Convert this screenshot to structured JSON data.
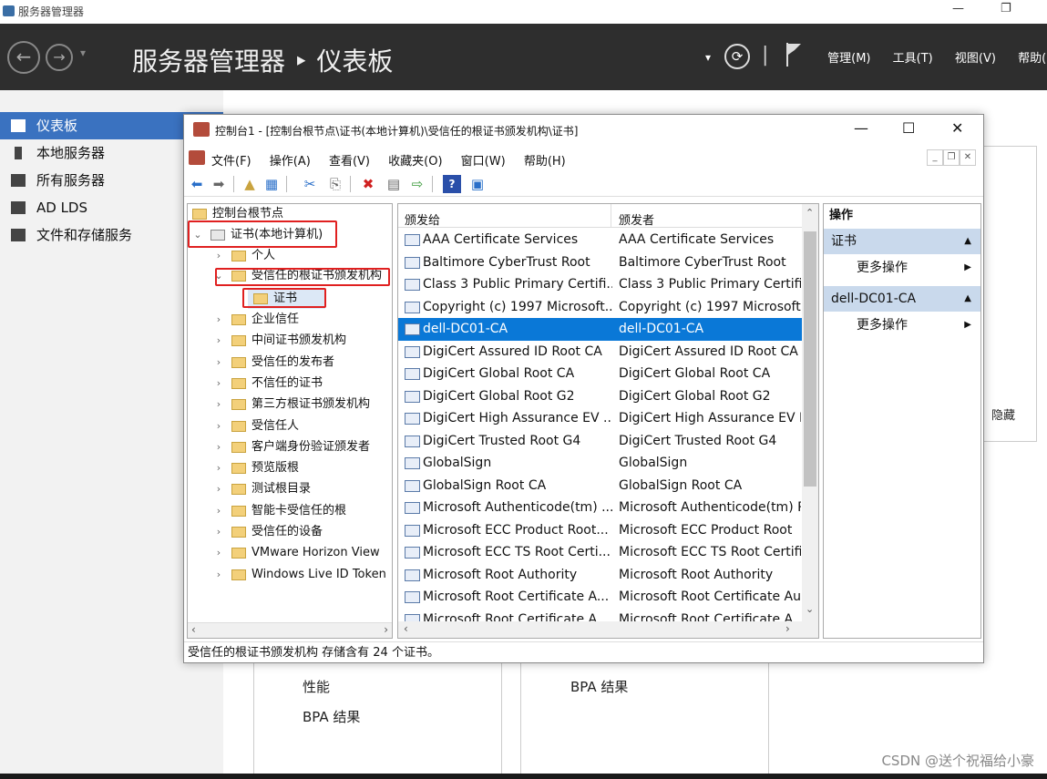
{
  "server_manager": {
    "window_title": "服务器管理器",
    "header_title": "服务器管理器 ‣ 仪表板",
    "menus": [
      "管理(M)",
      "工具(T)",
      "视图(V)",
      "帮助(H)"
    ],
    "sidebar": [
      {
        "label": "仪表板",
        "icon": "dashboard-icon",
        "active": true
      },
      {
        "label": "本地服务器",
        "icon": "server-icon"
      },
      {
        "label": "所有服务器",
        "icon": "servers-icon"
      },
      {
        "label": "AD LDS",
        "icon": "ad-lds-icon"
      },
      {
        "label": "文件和存储服务",
        "icon": "storage-icon"
      }
    ],
    "hide_label": "隐藏",
    "tiles_text": {
      "perf": "性能",
      "bpa1": "BPA 结果",
      "bpa2": "BPA 结果"
    },
    "watermark": "CSDN @送个祝福给小豪"
  },
  "mmc": {
    "title": "控制台1 - [控制台根节点\\证书(本地计算机)\\受信任的根证书颁发机构\\证书]",
    "menus": [
      "文件(F)",
      "操作(A)",
      "查看(V)",
      "收藏夹(O)",
      "窗口(W)",
      "帮助(H)"
    ],
    "tree": {
      "root": "控制台根节点",
      "computer": "证书(本地计算机)",
      "personal": "个人",
      "trusted_root": "受信任的根证书颁发机构",
      "certs": "证书",
      "others": [
        "企业信任",
        "中间证书颁发机构",
        "受信任的发布者",
        "不信任的证书",
        "第三方根证书颁发机构",
        "受信任人",
        "客户端身份验证颁发者",
        "预览版根",
        "测试根目录",
        "智能卡受信任的根",
        "受信任的设备",
        "VMware Horizon View",
        "Windows Live ID Token"
      ]
    },
    "list": {
      "col_issued_to": "颁发给",
      "col_issued_by": "颁发者",
      "selected_index": 4,
      "rows": [
        [
          "AAA Certificate Services",
          "AAA Certificate Services"
        ],
        [
          "Baltimore CyberTrust Root",
          "Baltimore CyberTrust Root"
        ],
        [
          "Class 3 Public Primary Certifi...",
          "Class 3 Public Primary Certific"
        ],
        [
          "Copyright (c) 1997 Microsoft...",
          "Copyright (c) 1997 Microsoft"
        ],
        [
          "dell-DC01-CA",
          "dell-DC01-CA"
        ],
        [
          "DigiCert Assured ID Root CA",
          "DigiCert Assured ID Root CA"
        ],
        [
          "DigiCert Global Root CA",
          "DigiCert Global Root CA"
        ],
        [
          "DigiCert Global Root G2",
          "DigiCert Global Root G2"
        ],
        [
          "DigiCert High Assurance EV ...",
          "DigiCert High Assurance EV R"
        ],
        [
          "DigiCert Trusted Root G4",
          "DigiCert Trusted Root G4"
        ],
        [
          "GlobalSign",
          "GlobalSign"
        ],
        [
          "GlobalSign Root CA",
          "GlobalSign Root CA"
        ],
        [
          "Microsoft Authenticode(tm) ...",
          "Microsoft Authenticode(tm) R"
        ],
        [
          "Microsoft ECC Product Root...",
          "Microsoft ECC Product Root"
        ],
        [
          "Microsoft ECC TS Root Certi...",
          "Microsoft ECC TS Root Certifi"
        ],
        [
          "Microsoft Root Authority",
          "Microsoft Root Authority"
        ],
        [
          "Microsoft Root Certificate A...",
          "Microsoft Root Certificate Au"
        ],
        [
          "Microsoft Root Certificate A...",
          "Microsoft Root Certificate A"
        ]
      ]
    },
    "actions": {
      "header": "操作",
      "sections": [
        {
          "title": "证书",
          "item": "更多操作"
        },
        {
          "title": "dell-DC01-CA",
          "item": "更多操作"
        }
      ]
    },
    "status": "受信任的根证书颁发机构 存储含有 24 个证书。"
  },
  "colors": {
    "accent": "#0a78d7",
    "header_bg": "#2e2e2e",
    "sidebar_active": "#3a72c0",
    "highlight_box": "#e02020"
  }
}
